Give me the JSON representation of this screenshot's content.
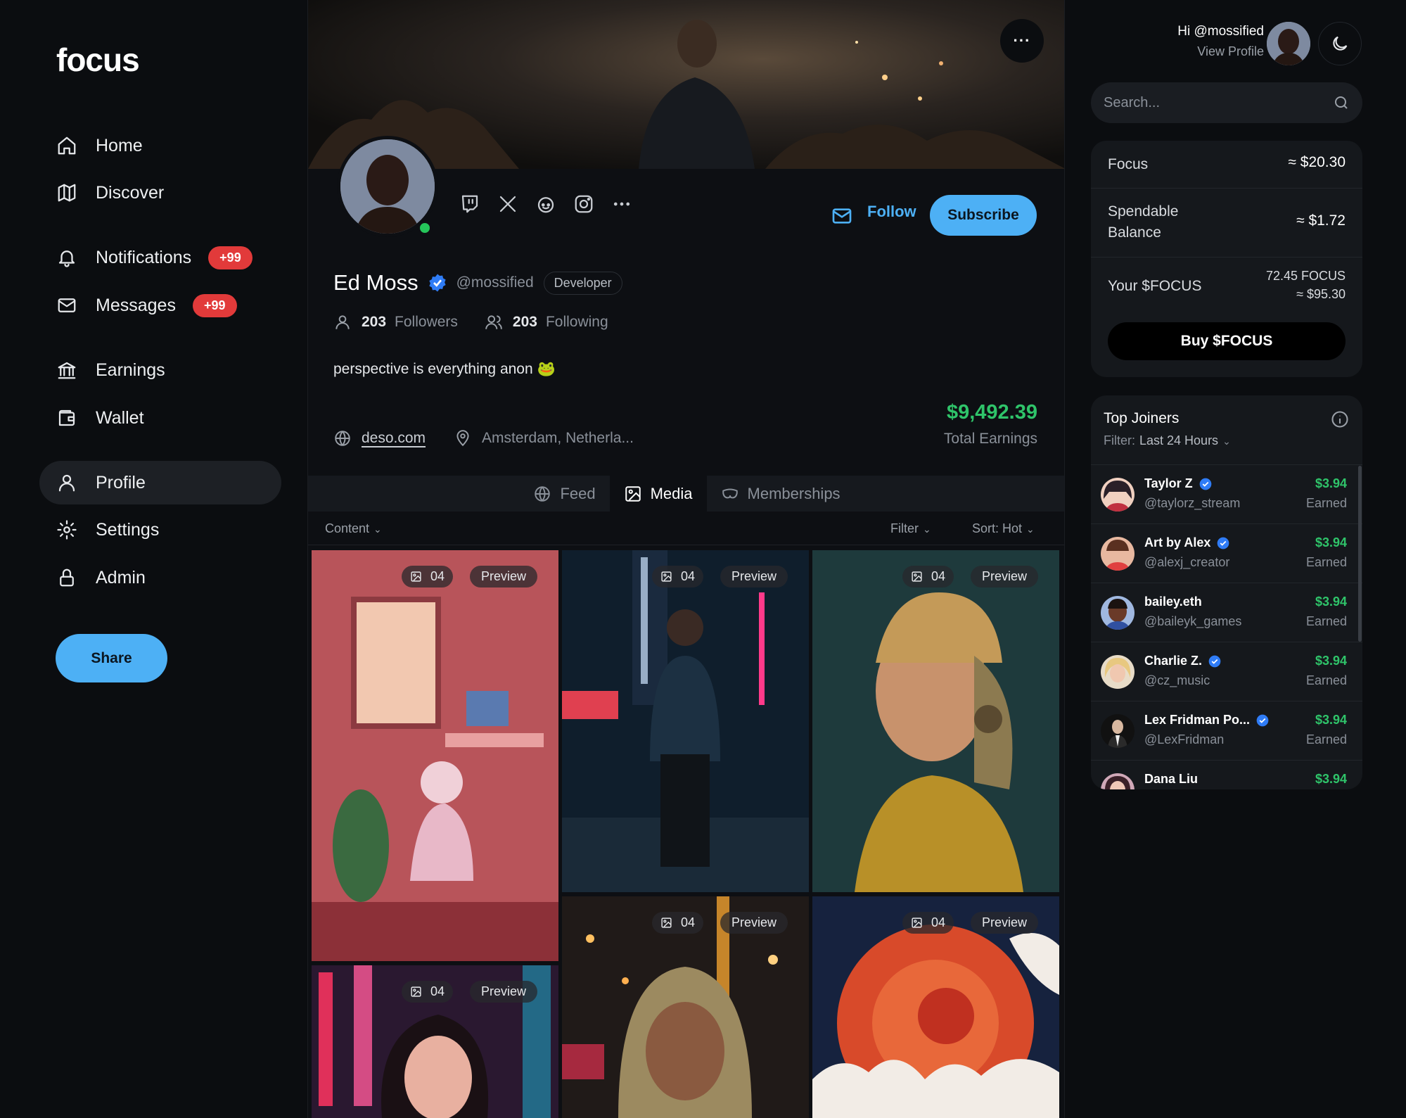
{
  "brand": "focus",
  "nav": [
    {
      "label": "Home",
      "icon": "home-icon"
    },
    {
      "label": "Discover",
      "icon": "map-icon"
    },
    {
      "label": "Notifications",
      "icon": "bell-icon",
      "badge": "+99"
    },
    {
      "label": "Messages",
      "icon": "mail-icon",
      "badge": "+99"
    },
    {
      "label": "Earnings",
      "icon": "bank-icon"
    },
    {
      "label": "Wallet",
      "icon": "wallet-icon"
    },
    {
      "label": "Profile",
      "icon": "user-icon",
      "active": true
    },
    {
      "label": "Settings",
      "icon": "gear-icon"
    },
    {
      "label": "Admin",
      "icon": "lock-icon"
    }
  ],
  "share_label": "Share",
  "profile": {
    "more_label": "···",
    "follow_label": "Follow",
    "subscribe_label": "Subscribe",
    "name": "Ed Moss",
    "handle": "@mossified",
    "role": "Developer",
    "followers_count": "203",
    "followers_label": "Followers",
    "following_count": "203",
    "following_label": "Following",
    "bio": "perspective is everything anon 🐸",
    "website": "deso.com",
    "location": "Amsterdam, Netherla...",
    "total_earnings": "$9,492.39",
    "total_earnings_label": "Total Earnings",
    "online": true
  },
  "tabs": [
    {
      "label": "Feed",
      "icon": "globe-icon"
    },
    {
      "label": "Media",
      "icon": "image-icon",
      "active": true
    },
    {
      "label": "Memberships",
      "icon": "mask-icon"
    }
  ],
  "toolbar": {
    "content_label": "Content",
    "filter_label": "Filter",
    "sort_label": "Sort:",
    "sort_value": "Hot"
  },
  "media": [
    {
      "count": "04",
      "preview": "Preview",
      "scene": "girl at desk in pink room"
    },
    {
      "count": "04",
      "preview": "Preview",
      "scene": "man in jacket on neon street"
    },
    {
      "count": "04",
      "preview": "Preview",
      "scene": "cyborg woman portrait"
    },
    {
      "count": "04",
      "preview": "Preview",
      "scene": "anime girl with neon signs"
    },
    {
      "count": "04",
      "preview": "Preview",
      "scene": "woman in hood with glasses"
    },
    {
      "count": "04",
      "preview": "Preview",
      "scene": "red planet with clouds"
    }
  ],
  "user": {
    "greeting": "Hi @mossified",
    "view_profile": "View Profile"
  },
  "search": {
    "placeholder": "Search..."
  },
  "balances": {
    "focus_label": "Focus",
    "focus_value": "≈ $20.30",
    "spendable_label": "Spendable Balance",
    "spendable_value": "≈ $1.72",
    "your_focus_label": "Your $FOCUS",
    "your_focus_amount": "72.45 FOCUS",
    "your_focus_value": "≈ $95.30",
    "buy_label": "Buy $FOCUS"
  },
  "joiners": {
    "title": "Top Joiners",
    "filter_label": "Filter:",
    "filter_value": "Last 24 Hours",
    "earned_label": "Earned",
    "items": [
      {
        "name": "Taylor Z",
        "handle": "@taylorz_stream",
        "amount": "$3.94",
        "verified": true
      },
      {
        "name": "Art by Alex",
        "handle": "@alexj_creator",
        "amount": "$3.94",
        "verified": true
      },
      {
        "name": "bailey.eth",
        "handle": "@baileyk_games",
        "amount": "$3.94",
        "verified": false
      },
      {
        "name": "Charlie Z.",
        "handle": "@cz_music",
        "amount": "$3.94",
        "verified": true
      },
      {
        "name": "Lex Fridman Po...",
        "handle": "@LexFridman",
        "amount": "$3.94",
        "verified": true
      },
      {
        "name": "Dana Liu",
        "handle": "",
        "amount": "$3.94",
        "verified": false
      }
    ]
  },
  "colors": {
    "accent": "#4db0f5",
    "earnings_green": "#2fc46a",
    "badge_red": "#e23a3a",
    "online_green": "#25c55a",
    "verified_blue": "#2f7cf6"
  }
}
